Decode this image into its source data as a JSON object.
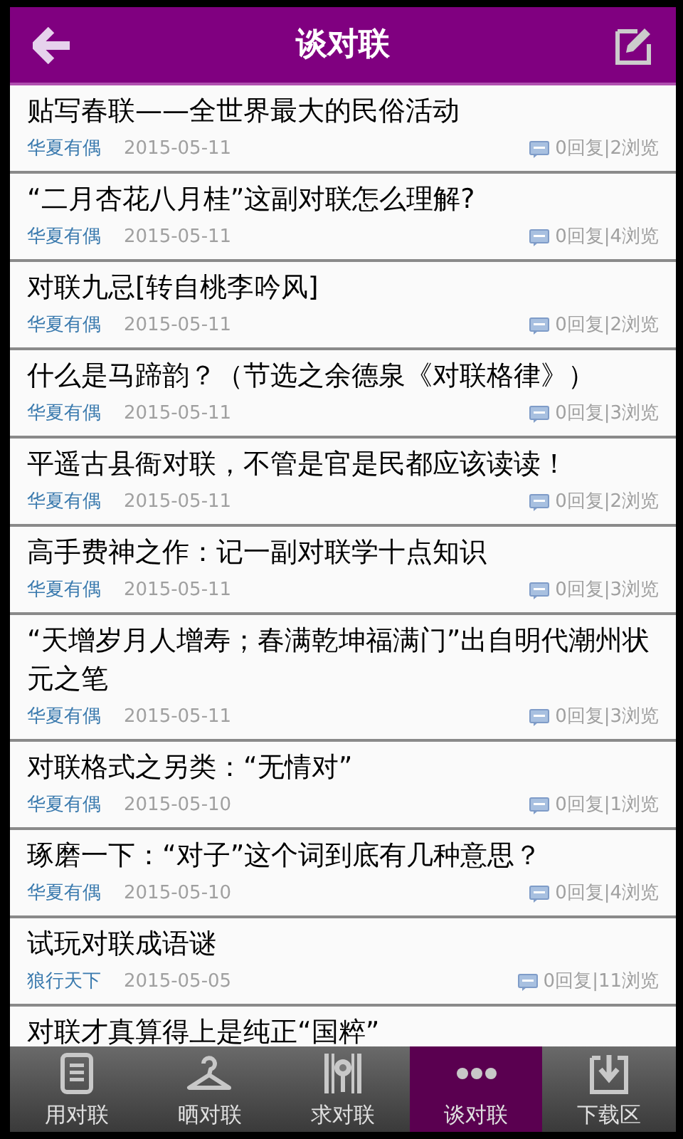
{
  "header": {
    "title": "谈对联"
  },
  "posts": [
    {
      "title": "贴写春联——全世界最大的民俗活动",
      "author": "华夏有偶",
      "date": "2015-05-11",
      "stats": "0回复|2浏览"
    },
    {
      "title": "“二月杏花八月桂”这副对联怎么理解?",
      "author": "华夏有偶",
      "date": "2015-05-11",
      "stats": "0回复|4浏览"
    },
    {
      "title": "对联九忌[转自桃李吟风]",
      "author": "华夏有偶",
      "date": "2015-05-11",
      "stats": "0回复|2浏览"
    },
    {
      "title": "什么是马蹄韵？（节选之余德泉《对联格律》）",
      "author": "华夏有偶",
      "date": "2015-05-11",
      "stats": "0回复|3浏览"
    },
    {
      "title": "平遥古县衙对联，不管是官是民都应该读读！",
      "author": "华夏有偶",
      "date": "2015-05-11",
      "stats": "0回复|2浏览"
    },
    {
      "title": "高手费神之作：记一副对联学十点知识",
      "author": "华夏有偶",
      "date": "2015-05-11",
      "stats": "0回复|3浏览"
    },
    {
      "title": "“天增岁月人增寿；春满乾坤福满门”出自明代潮州状元之笔",
      "author": "华夏有偶",
      "date": "2015-05-11",
      "stats": "0回复|3浏览"
    },
    {
      "title": "对联格式之另类：“无情对”",
      "author": "华夏有偶",
      "date": "2015-05-10",
      "stats": "0回复|1浏览"
    },
    {
      "title": "琢磨一下：“对子”这个词到底有几种意思？",
      "author": "华夏有偶",
      "date": "2015-05-10",
      "stats": "0回复|4浏览"
    },
    {
      "title": "试玩对联成语谜",
      "author": "狼行天下",
      "date": "2015-05-05",
      "stats": "0回复|11浏览"
    },
    {
      "title": "对联才真算得上是纯正“国粹”"
    }
  ],
  "tabs": [
    {
      "label": "用对联",
      "kind": "document",
      "selected": false
    },
    {
      "label": "晒对联",
      "kind": "hanger",
      "selected": false
    },
    {
      "label": "求对联",
      "kind": "search",
      "selected": false
    },
    {
      "label": "谈对联",
      "kind": "more",
      "selected": true
    },
    {
      "label": "下载区",
      "kind": "download",
      "selected": false
    }
  ]
}
